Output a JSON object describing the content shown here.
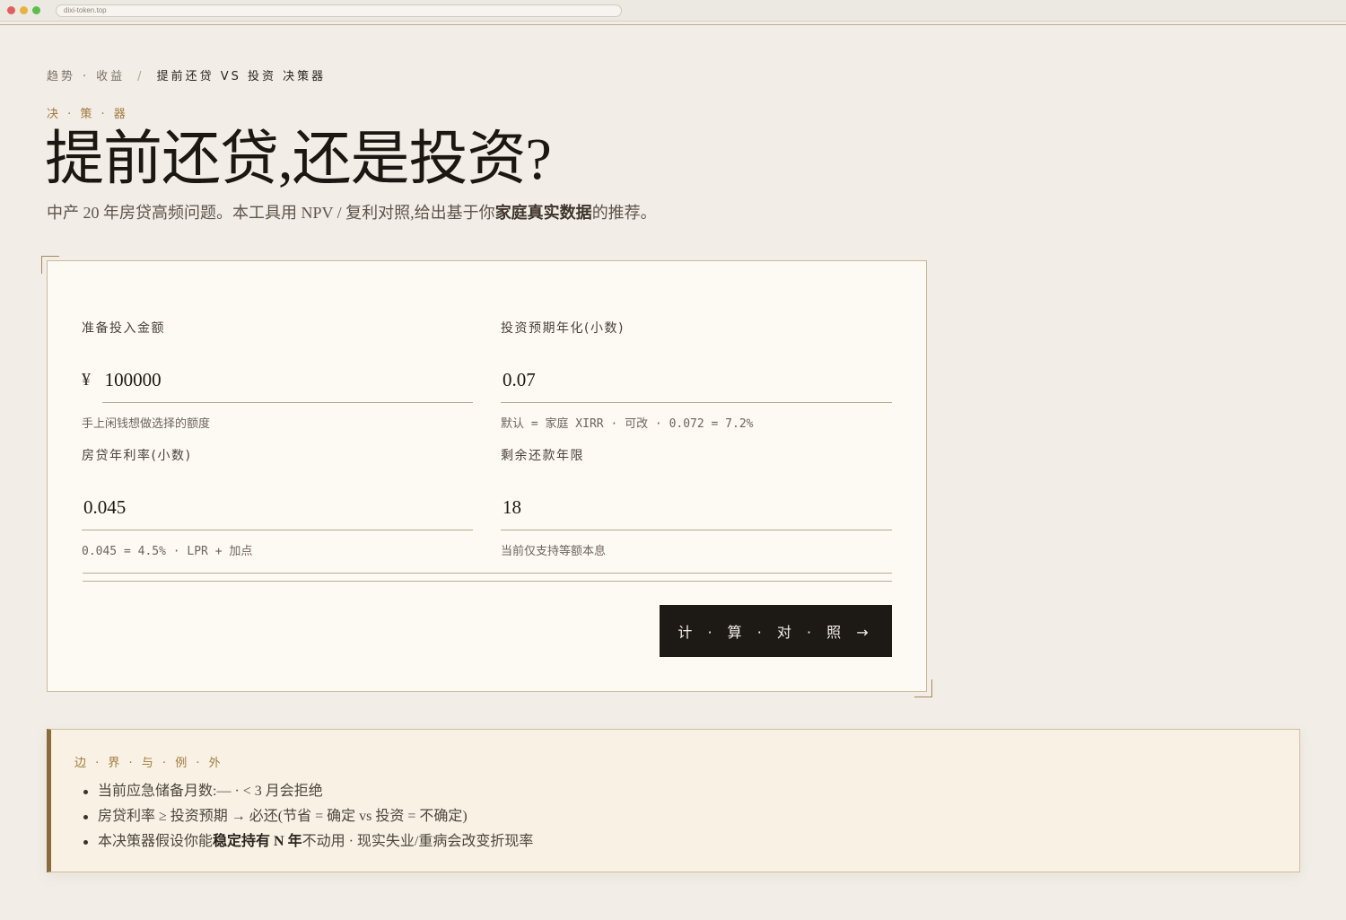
{
  "browser": {
    "url": "dixi-token.top"
  },
  "breadcrumb": {
    "part1": "趋势",
    "dot": "·",
    "part2": "收益",
    "sep": "/",
    "current": "提前还贷 VS 投资 决策器"
  },
  "eyebrow": "决 · 策 · 器",
  "title": "提前还贷,还是投资?",
  "subtitle": {
    "before": "中产 20 年房贷高频问题。本工具用 NPV / 复利对照,给出基于你",
    "bold": "家庭真实数据",
    "after": "的推荐。"
  },
  "form": {
    "amount": {
      "label": "准备投入金额",
      "prefix": "¥",
      "value": "100000",
      "hint": "手上闲钱想做选择的额度"
    },
    "expected_return": {
      "label": "投资预期年化(小数)",
      "value": "0.07",
      "hint": "默认 = 家庭 XIRR · 可改 · 0.072 = 7.2%"
    },
    "loan_rate": {
      "label": "房贷年利率(小数)",
      "value": "0.045",
      "hint": "0.045 = 4.5% · LPR + 加点"
    },
    "remaining_years": {
      "label": "剩余还款年限",
      "value": "18",
      "hint": "当前仅支持等额本息"
    },
    "calc_button": "计 · 算 · 对 · 照 →"
  },
  "note": {
    "title": "边 · 界 · 与 · 例 · 外",
    "item1": "当前应急储备月数:— · < 3 月会拒绝",
    "item2": "房贷利率 ≥ 投资预期 → 必还(节省 = 确定 vs 投资 = 不确定)",
    "item3_before": "本决策器假设你能",
    "item3_bold": "稳定持有 N 年",
    "item3_after": "不动用 · 现实失业/重病会改变折现率"
  },
  "colors": {
    "background": "#f2ede7",
    "accent_gold": "#a07a3c",
    "button_dark": "#1d1915",
    "card_bg": "#fdfaf4",
    "note_bg": "#f8f1e4"
  }
}
